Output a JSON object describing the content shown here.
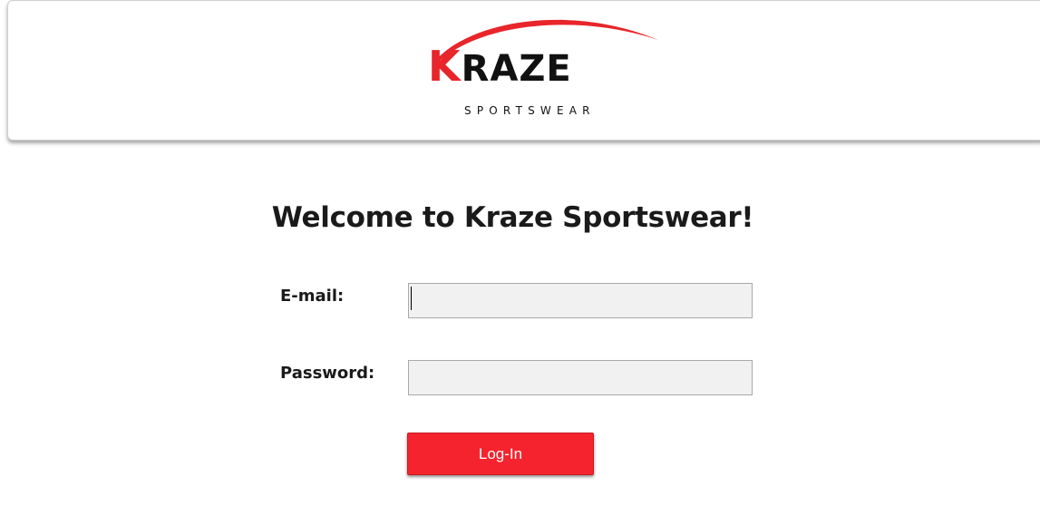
{
  "header": {
    "logo": {
      "wordmark": "KRAZE",
      "tagline": "SPORTSWEAR",
      "accent_color": "#e8252b"
    }
  },
  "main": {
    "title": "Welcome to Kraze Sportswear!",
    "email": {
      "label": "E-mail:",
      "value": "",
      "placeholder": ""
    },
    "password": {
      "label": "Password:",
      "value": "",
      "placeholder": ""
    },
    "login_button": {
      "label": "Log-In",
      "color": "#f5232d"
    }
  }
}
